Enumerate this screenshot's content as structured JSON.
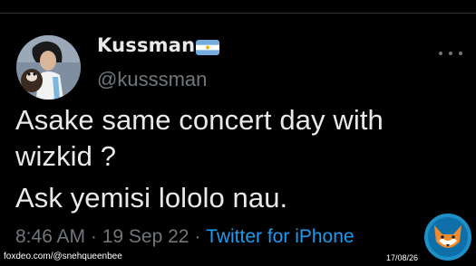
{
  "tweet": {
    "display_name": "Kussman",
    "handle": "@kusssman",
    "flag_icon": "argentina-flag-icon",
    "lines": [
      "Asake same concert day with",
      "wizkid ?",
      "Ask yemisi lololo nau."
    ],
    "time": "8:46 AM",
    "separator1": " · ",
    "date": "19 Sep 22",
    "separator2": " · ",
    "source": "Twitter for iPhone"
  },
  "watermark": {
    "site_handle": "foxdeo.com/@snehqueenbee",
    "date": "17/08/26",
    "logo_icon": "fox-logo-icon"
  },
  "colors": {
    "background": "#000000",
    "text": "#e7e9ea",
    "muted": "#71767b",
    "link": "#1d9bf0"
  }
}
